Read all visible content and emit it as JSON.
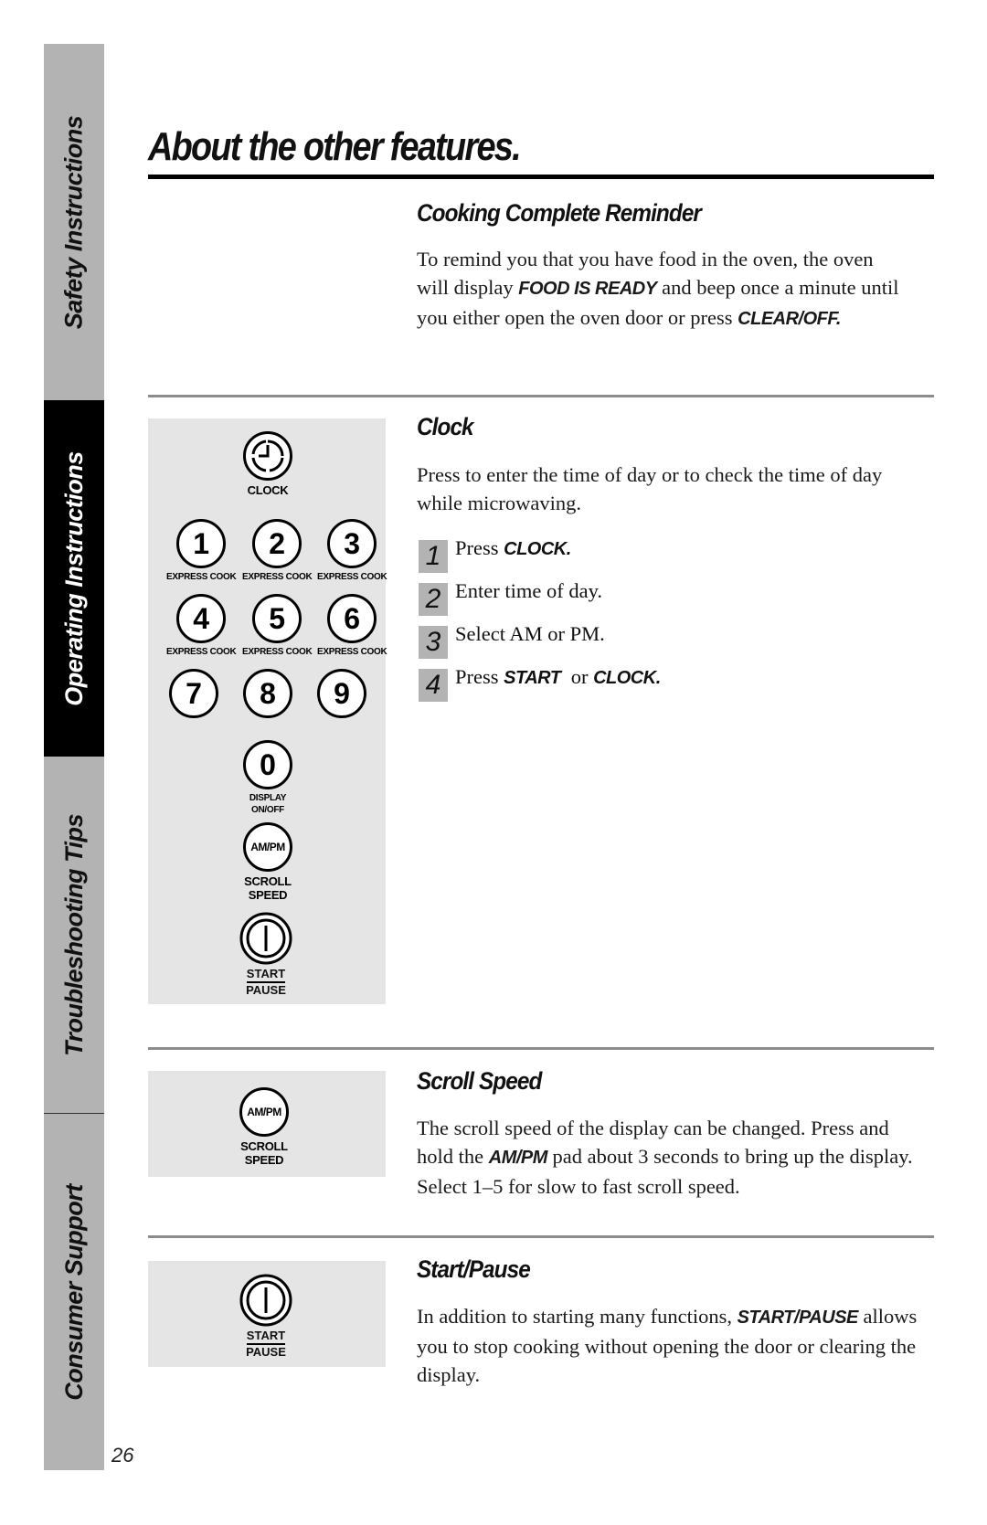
{
  "side_tabs": [
    {
      "label": "Safety Instructions",
      "active": false
    },
    {
      "label": "Operating Instructions",
      "active": true
    },
    {
      "label": "Troubleshooting Tips",
      "active": false
    },
    {
      "label": "Consumer Support",
      "active": false
    }
  ],
  "page_number": "26",
  "title": "About the other features.",
  "sections": {
    "cooking_complete": {
      "heading": "Cooking Complete Reminder",
      "text_1": "To remind you that you have food in the oven, the oven will display ",
      "kw_1": "FOOD IS READY",
      "text_2": " and beep once a minute until you either open the oven door or press ",
      "kw_2": "CLEAR/OFF."
    },
    "clock": {
      "heading": "Clock",
      "intro": "Press to enter the time of day or to check the time of day while microwaving.",
      "steps": [
        {
          "num": "1",
          "text": "Press ",
          "kw": "CLOCK.",
          "text2": "",
          "kw2": ""
        },
        {
          "num": "2",
          "text": "Enter time of day.",
          "kw": "",
          "text2": "",
          "kw2": ""
        },
        {
          "num": "3",
          "text": "Select AM or PM.",
          "kw": "",
          "text2": "",
          "kw2": ""
        },
        {
          "num": "4",
          "text": "Press ",
          "kw": "START",
          "text2": "  or ",
          "kw2": "CLOCK."
        }
      ]
    },
    "scroll_speed": {
      "heading": "Scroll Speed",
      "text_1": "The scroll speed of the display can be changed. Press and hold the ",
      "kw_1": "AM/PM",
      "text_2": "  pad about 3 seconds to bring up the display. Select 1–5 for slow to fast scroll speed."
    },
    "start_pause": {
      "heading": "Start/Pause",
      "text_1": "In addition to starting many functions, ",
      "kw_1": "START/PAUSE",
      "text_2": " allows you to stop cooking without opening the door or clearing the display."
    }
  },
  "keypad": {
    "clock_label": "CLOCK",
    "digits": [
      "1",
      "2",
      "3",
      "4",
      "5",
      "6",
      "7",
      "8",
      "9"
    ],
    "express_label": "EXPRESS COOK",
    "zero": "0",
    "zero_label_1": "DISPLAY",
    "zero_label_2": "ON/OFF",
    "ampm": "AM/PM",
    "scroll_label_1": "SCROLL",
    "scroll_label_2": "SPEED",
    "start_label": "START",
    "pause_label": "PAUSE"
  }
}
